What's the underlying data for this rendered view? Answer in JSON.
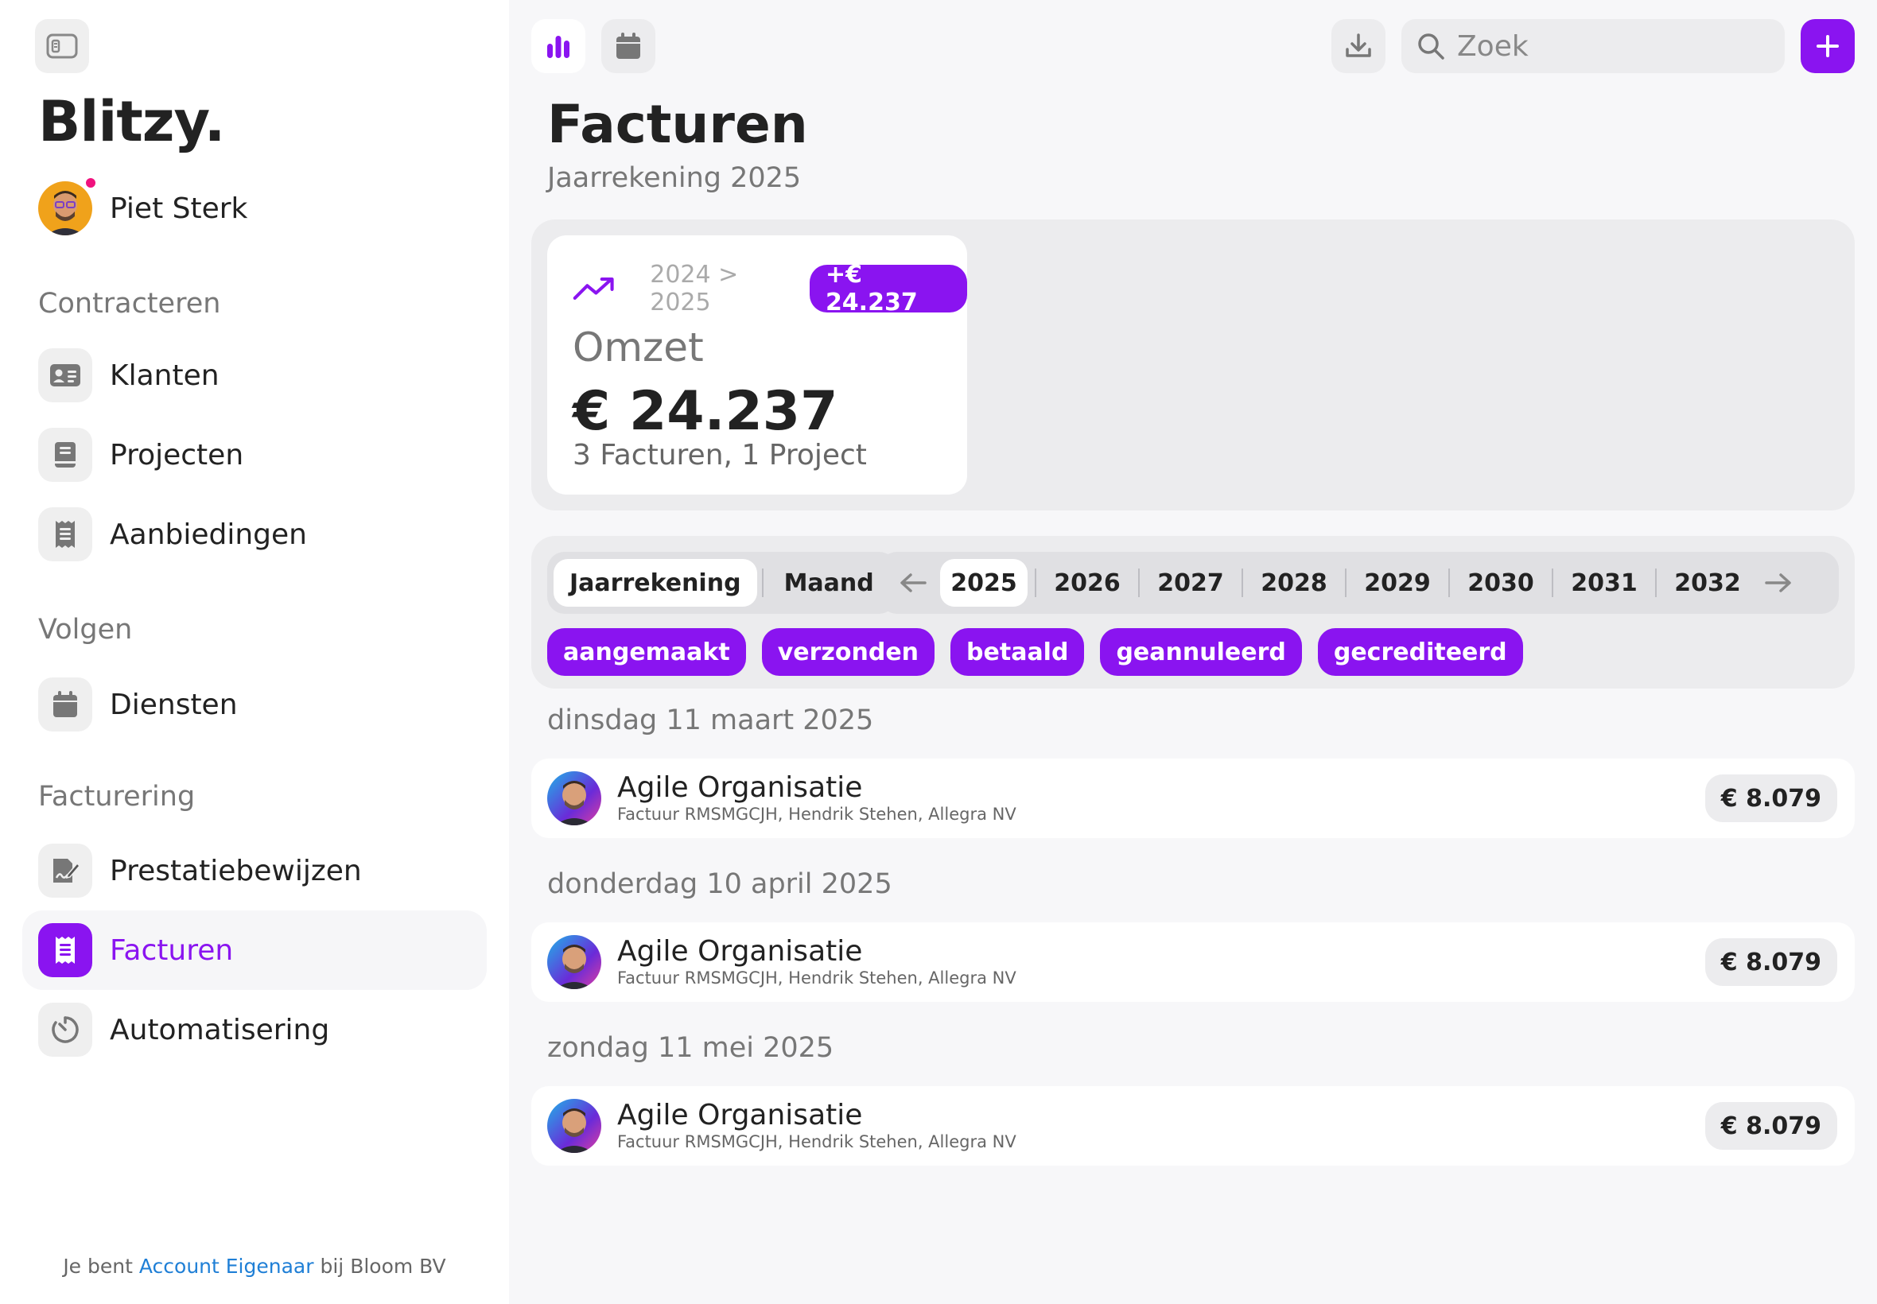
{
  "app": {
    "brand": "Blitzy."
  },
  "user": {
    "name": "Piet Sterk"
  },
  "sidebar": {
    "sections": [
      {
        "title": "Contracteren",
        "items": [
          {
            "label": "Klanten",
            "icon": "contact-card-icon"
          },
          {
            "label": "Projecten",
            "icon": "book-icon"
          },
          {
            "label": "Aanbiedingen",
            "icon": "receipt-icon"
          }
        ]
      },
      {
        "title": "Volgen",
        "items": [
          {
            "label": "Diensten",
            "icon": "calendar-icon"
          }
        ]
      },
      {
        "title": "Facturering",
        "items": [
          {
            "label": "Prestatiebewijzen",
            "icon": "signature-icon"
          },
          {
            "label": "Facturen",
            "icon": "invoice-icon",
            "active": true
          },
          {
            "label": "Automatisering",
            "icon": "timer-icon"
          }
        ]
      }
    ],
    "footer": {
      "prefix": "Je bent",
      "role": "Account Eigenaar",
      "suffix": "bij Bloom BV"
    }
  },
  "topbar": {
    "search_placeholder": "Zoek"
  },
  "header": {
    "title": "Facturen",
    "subtitle": "Jaarrekening 2025"
  },
  "summary": {
    "range": "2024 > 2025",
    "badge": "+€ 24.237",
    "label": "Omzet",
    "value": "€ 24.237",
    "meta": "3 Facturen, 1 Project"
  },
  "filters": {
    "modes": [
      "Jaarrekening",
      "Maand"
    ],
    "selected_mode": "Jaarrekening",
    "years": [
      "2025",
      "2026",
      "2027",
      "2028",
      "2029",
      "2030",
      "2031",
      "2032"
    ],
    "selected_year": "2025",
    "statuses": [
      "aangemaakt",
      "verzonden",
      "betaald",
      "geannuleerd",
      "gecrediteerd"
    ]
  },
  "invoices": [
    {
      "date": "dinsdag 11 maart 2025",
      "title": "Agile Organisatie",
      "subtitle": "Factuur RMSMGCJH, Hendrik Stehen, Allegra NV",
      "amount": "€ 8.079"
    },
    {
      "date": "donderdag 10 april 2025",
      "title": "Agile Organisatie",
      "subtitle": "Factuur RMSMGCJH, Hendrik Stehen, Allegra NV",
      "amount": "€ 8.079"
    },
    {
      "date": "zondag 11 mei 2025",
      "title": "Agile Organisatie",
      "subtitle": "Factuur RMSMGCJH, Hendrik Stehen, Allegra NV",
      "amount": "€ 8.079"
    }
  ],
  "colors": {
    "accent": "#8a14f0",
    "link": "#1f7fd6",
    "notification": "#f0127e"
  }
}
